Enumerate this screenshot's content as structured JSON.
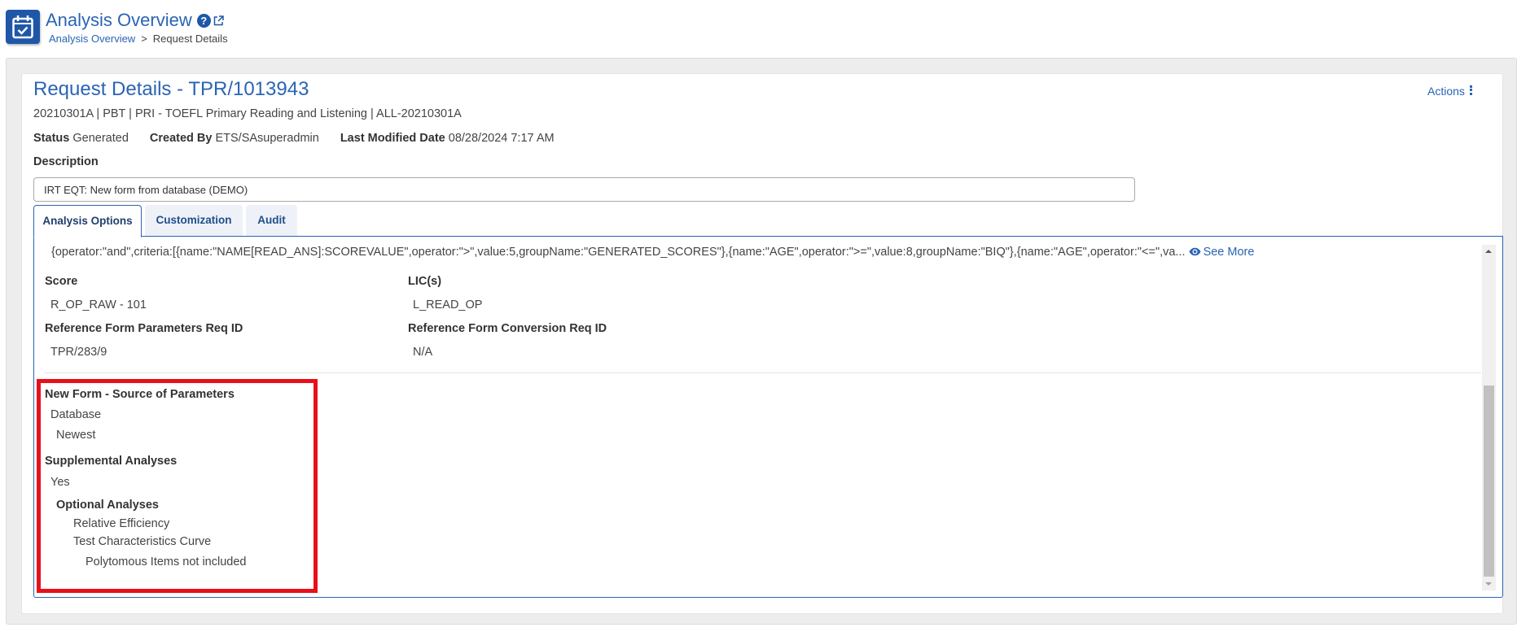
{
  "header": {
    "app_title": "Analysis Overview",
    "icons": {
      "app": "calendar-check-icon",
      "help": "question-circle-icon",
      "external": "external-link-icon"
    },
    "breadcrumb": {
      "link": "Analysis Overview",
      "separator": ">",
      "current": "Request Details"
    }
  },
  "request": {
    "title": "Request Details - TPR/1013943",
    "actions_label": "Actions",
    "subline": "20210301A | PBT | PRI - TOEFL Primary Reading and Listening | ALL-20210301A",
    "status_label": "Status",
    "status_value": "Generated",
    "created_by_label": "Created By",
    "created_by_value": "ETS/SAsuperadmin",
    "last_modified_label": "Last Modified Date",
    "last_modified_value": "08/28/2024 7:17 AM",
    "description_label": "Description",
    "description_value": "IRT EQT: New form from database (DEMO)"
  },
  "tabs": [
    {
      "label": "Analysis Options",
      "active": true
    },
    {
      "label": "Customization",
      "active": false
    },
    {
      "label": "Audit",
      "active": false
    }
  ],
  "analysis_options": {
    "criteria_text": "{operator:\"and\",criteria:[{name:\"NAME[READ_ANS]:SCOREVALUE\",operator:\">\",value:5,groupName:\"GENERATED_SCORES\"},{name:\"AGE\",operator:\">=\",value:8,groupName:\"BIQ\"},{name:\"AGE\",operator:\"<=\",va...",
    "see_more_label": "See More",
    "score_label": "Score",
    "score_value": "R_OP_RAW - 101",
    "lics_label": "LIC(s)",
    "lics_value": "L_READ_OP",
    "ref_params_label": "Reference Form Parameters Req ID",
    "ref_params_value": "TPR/283/9",
    "ref_conversion_label": "Reference Form Conversion Req ID",
    "ref_conversion_value": "N/A",
    "new_form_label": "New Form - Source of Parameters",
    "new_form_source": "Database",
    "new_form_version": "Newest",
    "supplemental_label": "Supplemental Analyses",
    "supplemental_value": "Yes",
    "optional_label": "Optional Analyses",
    "optional_items": [
      "Relative Efficiency",
      "Test Characteristics Curve"
    ],
    "optional_note": "Polytomous Items not included"
  },
  "colors": {
    "accent": "#2a64b4",
    "icon_bg": "#1f57a8",
    "highlight": "#e8101a"
  }
}
